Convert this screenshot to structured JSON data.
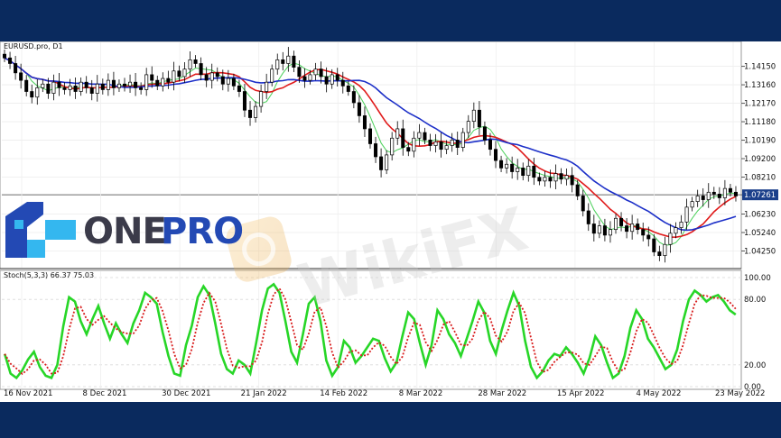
{
  "chart_data": {
    "type": "candlestick",
    "symbol_label": "EURUSD.pro, D1",
    "price_ticks": [
      "1.14150",
      "1.13160",
      "1.12170",
      "1.11180",
      "1.10190",
      "1.09200",
      "1.08210",
      "1.07261",
      "1.06230",
      "1.05240",
      "1.04250"
    ],
    "current_price": "1.07261",
    "ylim": [
      1.035,
      1.15
    ],
    "stoch_label": "Stoch(5,3,3) 66.37 75.03",
    "stoch_ticks": [
      "100.00",
      "80.00",
      "20.00",
      "0.00"
    ],
    "x_labels": [
      "16 Nov 2021",
      "8 Dec 2021",
      "30 Dec 2021",
      "21 Jan 2022",
      "14 Feb 2022",
      "8 Mar 2022",
      "28 Mar 2022",
      "15 Apr 2022",
      "4 May 2022",
      "23 May 2022"
    ],
    "close_series": [
      1.146,
      1.143,
      1.138,
      1.134,
      1.128,
      1.125,
      1.13,
      1.132,
      1.127,
      1.133,
      1.13,
      1.129,
      1.131,
      1.128,
      1.133,
      1.13,
      1.127,
      1.132,
      1.129,
      1.134,
      1.13,
      1.132,
      1.131,
      1.133,
      1.13,
      1.129,
      1.137,
      1.134,
      1.131,
      1.135,
      1.133,
      1.139,
      1.136,
      1.14,
      1.145,
      1.143,
      1.137,
      1.134,
      1.138,
      1.136,
      1.132,
      1.135,
      1.131,
      1.128,
      1.118,
      1.114,
      1.12,
      1.128,
      1.133,
      1.14,
      1.145,
      1.143,
      1.147,
      1.141,
      1.136,
      1.134,
      1.137,
      1.14,
      1.136,
      1.132,
      1.137,
      1.134,
      1.131,
      1.128,
      1.122,
      1.115,
      1.108,
      1.1,
      1.093,
      1.086,
      1.094,
      1.103,
      1.108,
      1.098,
      1.096,
      1.103,
      1.106,
      1.102,
      1.099,
      1.101,
      1.097,
      1.099,
      1.102,
      1.098,
      1.106,
      1.112,
      1.118,
      1.109,
      1.102,
      1.097,
      1.091,
      1.087,
      1.089,
      1.085,
      1.087,
      1.083,
      1.088,
      1.082,
      1.08,
      1.082,
      1.08,
      1.084,
      1.081,
      1.083,
      1.078,
      1.072,
      1.064,
      1.057,
      1.052,
      1.056,
      1.051,
      1.054,
      1.06,
      1.056,
      1.053,
      1.057,
      1.054,
      1.051,
      1.049,
      1.042,
      1.04,
      1.046,
      1.052,
      1.055,
      1.058,
      1.066,
      1.069,
      1.072,
      1.07,
      1.074,
      1.073,
      1.071,
      1.076,
      1.074,
      1.072
    ],
    "stoch_series": [
      30,
      12,
      8,
      15,
      25,
      32,
      18,
      10,
      8,
      20,
      55,
      82,
      78,
      60,
      48,
      62,
      74,
      58,
      44,
      58,
      48,
      40,
      58,
      70,
      86,
      82,
      76,
      50,
      28,
      12,
      10,
      38,
      56,
      82,
      92,
      84,
      58,
      30,
      16,
      12,
      24,
      20,
      12,
      40,
      70,
      90,
      94,
      86,
      60,
      32,
      22,
      48,
      76,
      82,
      60,
      24,
      10,
      18,
      42,
      36,
      22,
      28,
      36,
      44,
      42,
      26,
      14,
      22,
      46,
      68,
      62,
      40,
      20,
      38,
      70,
      62,
      48,
      40,
      28,
      44,
      60,
      78,
      68,
      42,
      30,
      52,
      70,
      86,
      74,
      42,
      18,
      8,
      14,
      24,
      30,
      28,
      36,
      30,
      22,
      12,
      26,
      46,
      38,
      22,
      8,
      12,
      28,
      54,
      70,
      62,
      44,
      36,
      26,
      16,
      20,
      34,
      60,
      80,
      88,
      84,
      78,
      82,
      84,
      78,
      70,
      66
    ]
  }
}
